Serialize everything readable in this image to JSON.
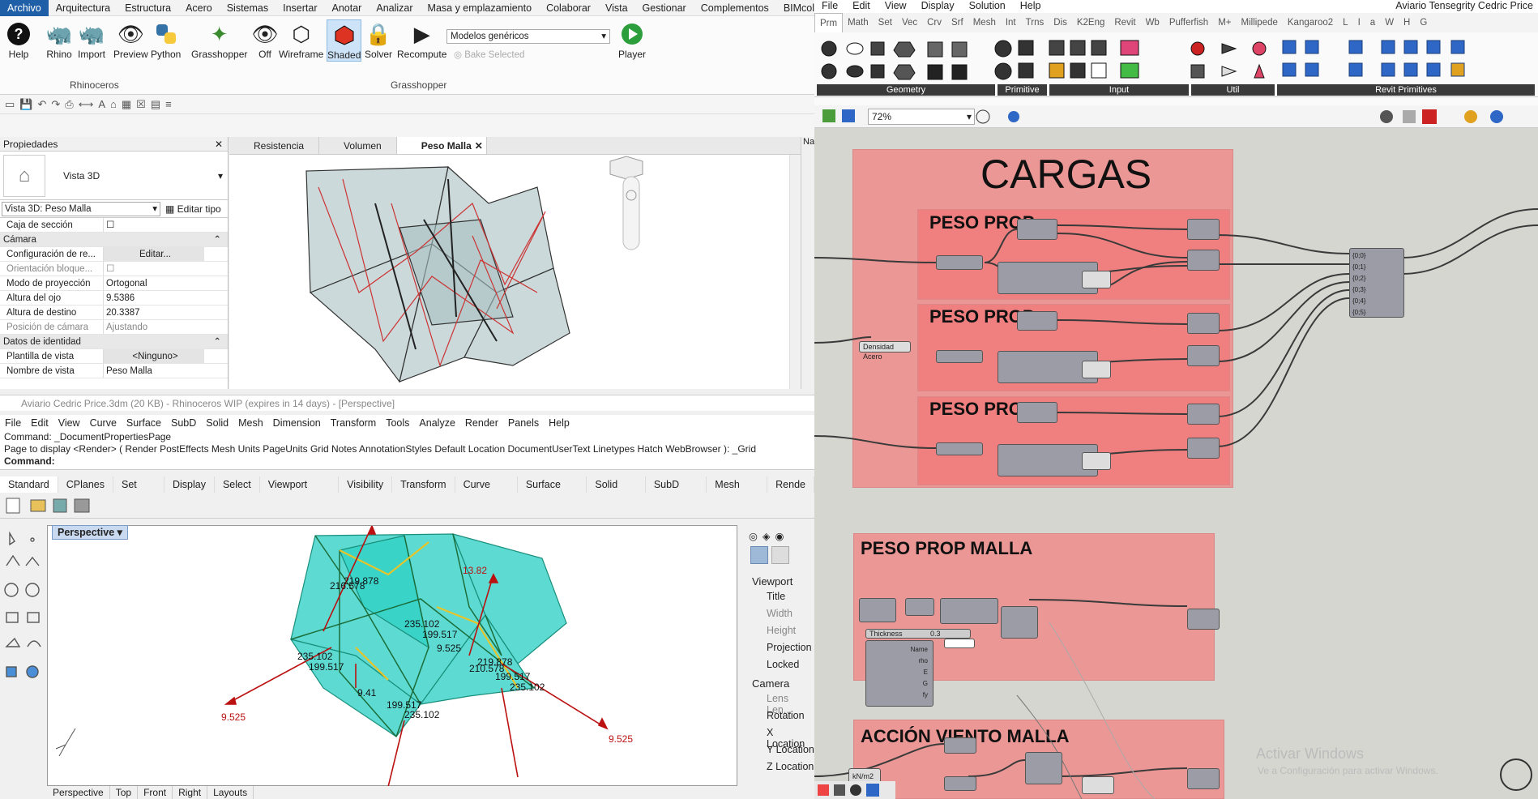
{
  "revit": {
    "menu": [
      "Archivo",
      "Arquitectura",
      "Estructura",
      "Acero",
      "Sistemas",
      "Insertar",
      "Anotar",
      "Analizar",
      "Masa y emplazamiento",
      "Colaborar",
      "Vista",
      "Gestionar",
      "Complementos",
      "BIMcollab"
    ],
    "ribbon_buttons": [
      "Help",
      "Rhino",
      "Import",
      "Preview",
      "Python",
      "Grasshopper",
      "Off",
      "Wireframe",
      "Shaded",
      "Solver",
      "Recompute",
      "Player"
    ],
    "group_labels": {
      "rhinoceros": "Rhinoceros",
      "grasshopper": "Grasshopper"
    },
    "dropdown_value": "Modelos genéricos",
    "bake_label": "Bake Selected",
    "properties": {
      "title": "Propiedades",
      "type_name": "Vista 3D",
      "selector": "Vista 3D: Peso Malla",
      "edit_type": "Editar tipo",
      "rows": [
        {
          "k": "Caja de sección",
          "v": "☐"
        },
        {
          "k": "Cámara",
          "v": "",
          "sec": true
        },
        {
          "k": "Configuración de re...",
          "v": "Editar..."
        },
        {
          "k": "Orientación bloque...",
          "v": "☐",
          "gray": true
        },
        {
          "k": "Modo de proyección",
          "v": "Ortogonal"
        },
        {
          "k": "Altura del ojo",
          "v": "9.5386"
        },
        {
          "k": "Altura de destino",
          "v": "20.3387"
        },
        {
          "k": "Posición de cámara",
          "v": "Ajustando",
          "gray": true
        },
        {
          "k": "Datos de identidad",
          "v": "",
          "sec": true
        },
        {
          "k": "Plantilla de vista",
          "v": "<Ninguno>"
        },
        {
          "k": "Nombre de vista",
          "v": "Peso Malla"
        }
      ]
    },
    "view_tabs": [
      "Resistencia",
      "Volumen",
      "Peso Malla"
    ],
    "side_label": "Na"
  },
  "rhino": {
    "title": "Aviario Cedric Price.3dm (20 KB) - Rhinoceros WIP (expires in 14 days) - [Perspective]",
    "menu": [
      "File",
      "Edit",
      "View",
      "Curve",
      "Surface",
      "SubD",
      "Solid",
      "Mesh",
      "Dimension",
      "Transform",
      "Tools",
      "Analyze",
      "Render",
      "Panels",
      "Help"
    ],
    "cmd1": "Command: _DocumentPropertiesPage",
    "cmd2": "Page to display <Render> ( Render PostEffects Mesh Units PageUnits Grid Notes AnnotationStyles Default Location DocumentUserText Linetypes Hatch WebBrowser ): _Grid",
    "cmd3": "Command:",
    "tabs": [
      "Standard",
      "CPlanes",
      "Set View",
      "Display",
      "Select",
      "Viewport Layout",
      "Visibility",
      "Transform",
      "Curve Tools",
      "Surface Tools",
      "Solid Tools",
      "SubD Tools",
      "Mesh Tools",
      "Rende"
    ],
    "viewport": "Perspective",
    "bottom_tabs": [
      "Perspective",
      "Top",
      "Front",
      "Right",
      "Layouts"
    ],
    "right_panel": {
      "viewport_h": "Viewport",
      "rows1": [
        "Title",
        "Width",
        "Height",
        "Projection",
        "Locked"
      ],
      "camera_h": "Camera",
      "rows2": [
        "Lens Len...",
        "Rotation",
        "X Location",
        "Y Location",
        "Z Location"
      ]
    },
    "labels": [
      "219.878",
      "216.578",
      "235.102",
      "199.517",
      "9.525",
      "235.102",
      "199.517",
      "9.41",
      "199.517",
      "235.102",
      "210.578",
      "219.878",
      "199.517",
      "235.102",
      "13.82",
      "9.525",
      "9.525"
    ]
  },
  "gh": {
    "menu": [
      "File",
      "Edit",
      "View",
      "Display",
      "Solution",
      "Help"
    ],
    "title": "Aviario Tensegrity Cedric Price",
    "tabs": [
      "Prm",
      "Math",
      "Set",
      "Vec",
      "Crv",
      "Srf",
      "Mesh",
      "Int",
      "Trns",
      "Dis",
      "K2Eng",
      "Revit",
      "Wb",
      "Pufferfish",
      "M+",
      "Millipede",
      "Kangaroo2",
      "L",
      "I",
      "a",
      "W",
      "H",
      "G"
    ],
    "categories": [
      "Geometry",
      "Primitive",
      "Input",
      "Util",
      "Revit Primitives"
    ],
    "zoom": "72%",
    "groups": {
      "cargas": "CARGAS",
      "peso1": "PESO PROP",
      "peso2": "PESO PROP",
      "peso3": "PESO PROP",
      "malla": "PESO PROP MALLA",
      "viento": "ACCIÓN VIENTO MALLA"
    },
    "density_label": "Densidad Acero",
    "thickness_label": "Thickness",
    "thickness_val": "0.3",
    "matld_outputs": [
      "Name",
      "rho",
      "E",
      "G",
      "fy"
    ],
    "merge_inputs": [
      "{0;0}",
      "{0;1}",
      "{0;2}",
      "{0;3}",
      "{0;4}",
      "{0;5}"
    ],
    "unit_label": "kN/m2"
  },
  "watermark": {
    "l1": "Activar Windows",
    "l2": "Ve a Configuración para activar Windows."
  }
}
